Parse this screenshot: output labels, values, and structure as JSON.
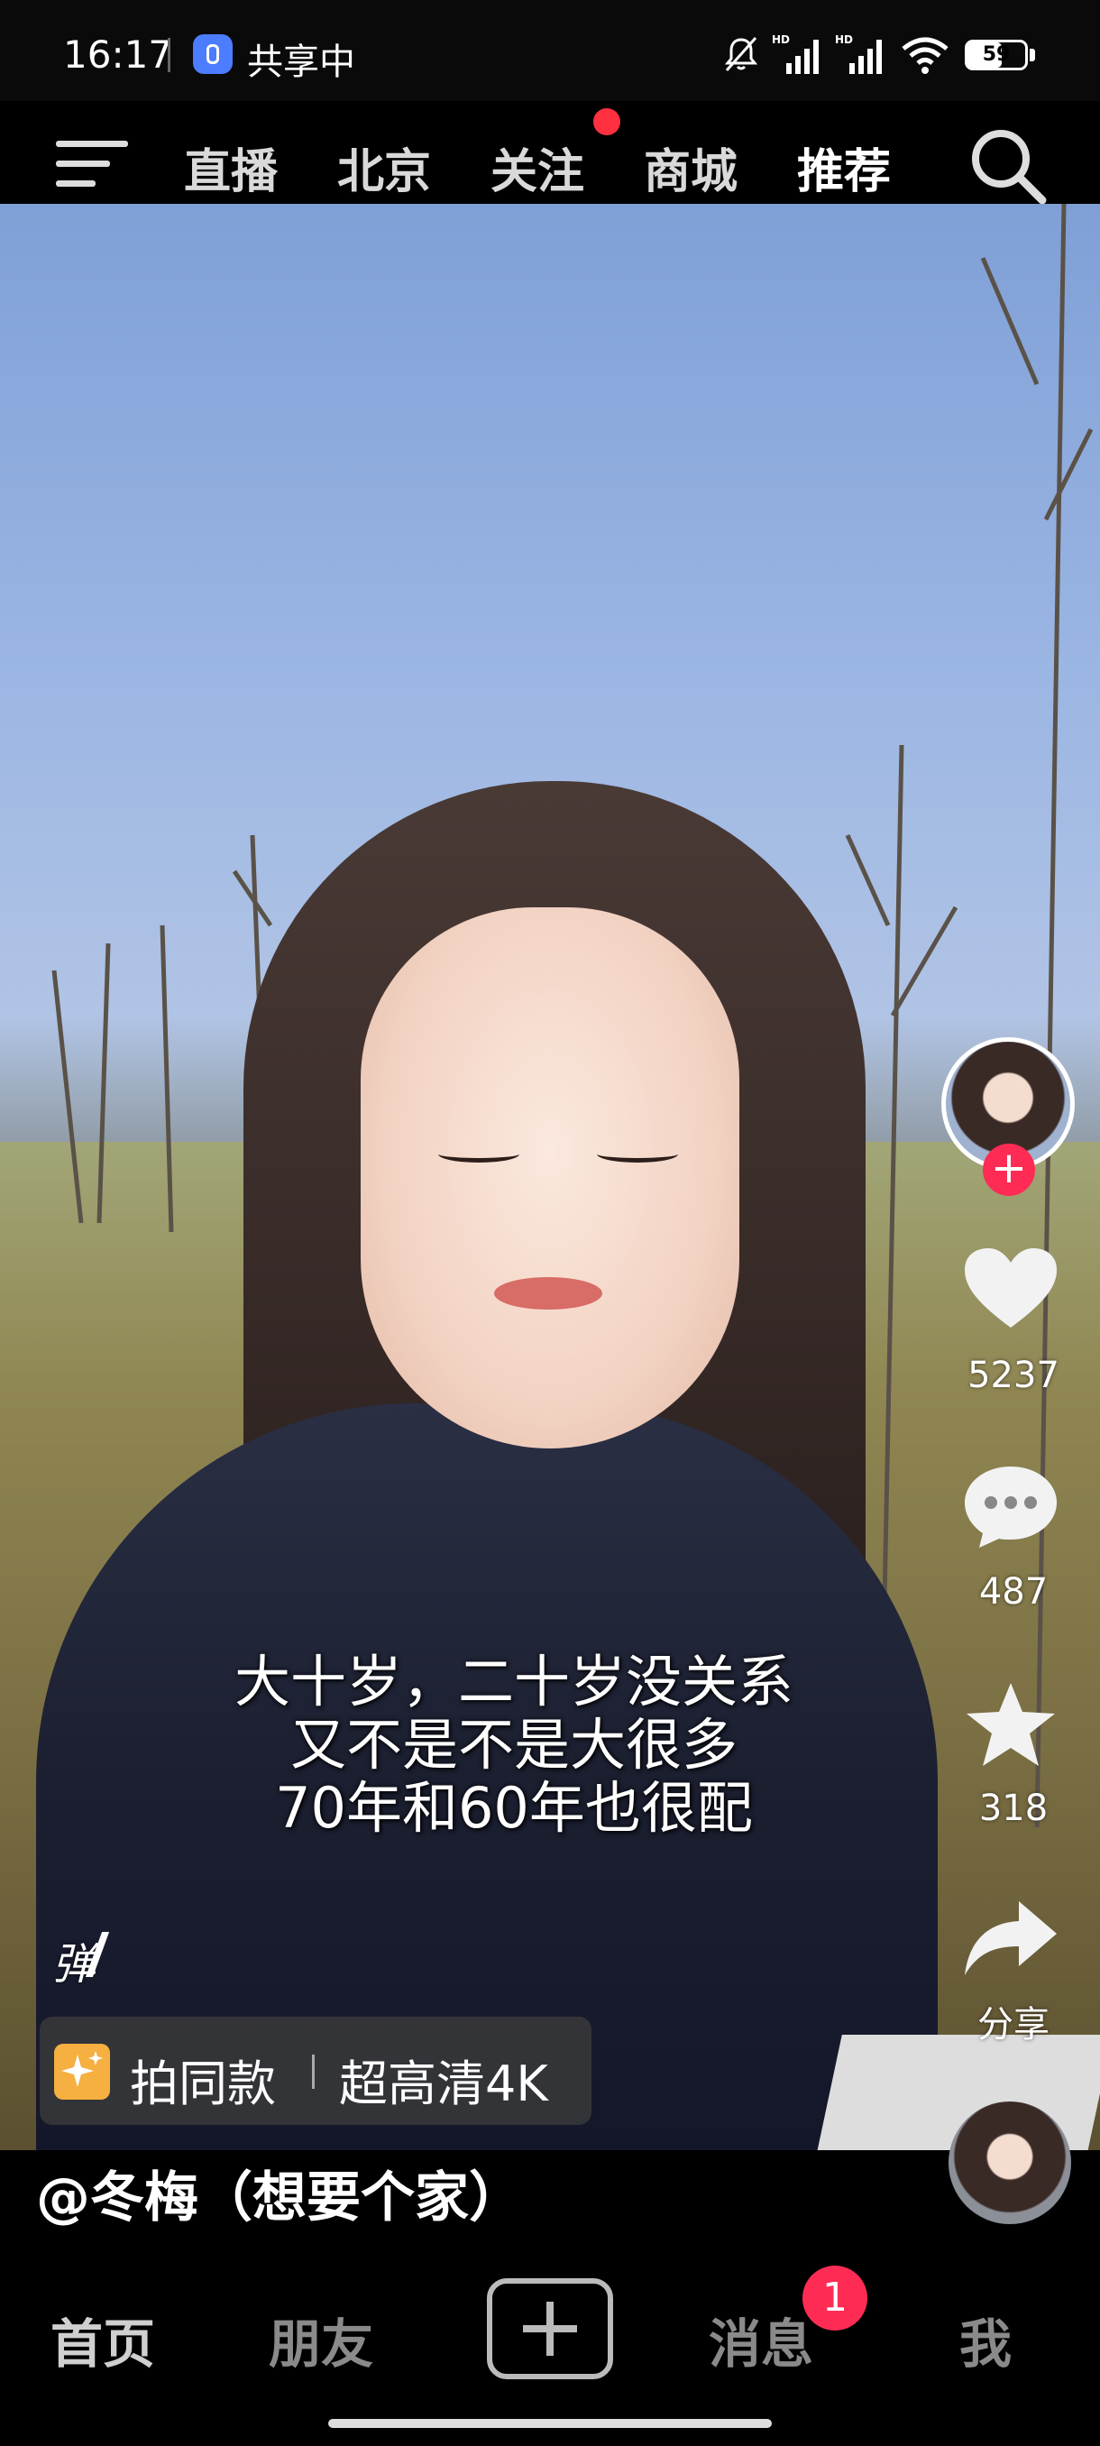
{
  "status_bar": {
    "time": "16:17",
    "share_label": "共享中",
    "battery": "59",
    "icons": [
      "share-screen-icon",
      "mute-bell-icon",
      "signal-hd-icon",
      "signal-hd-icon",
      "wifi-icon",
      "battery-icon"
    ]
  },
  "top_nav": {
    "tabs": [
      "直播",
      "北京",
      "关注",
      "商城",
      "推荐"
    ],
    "active_tab": "推荐",
    "icons": [
      "menu-icon",
      "search-icon"
    ]
  },
  "video": {
    "caption": [
      "大十岁，二十岁没关系",
      "又不是不是大很多",
      "70年和60年也很配"
    ],
    "danmu_label": "弹",
    "template_label": "拍同款",
    "quality_label": "超高清4K",
    "author": "@冬梅（想要个家）"
  },
  "side_rail": {
    "follow_plus": "+",
    "likes": "5237",
    "comments": "487",
    "favorites": "318",
    "share_label": "分享"
  },
  "bottom_nav": {
    "home": "首页",
    "friends": "朋友",
    "messages": "消息",
    "me": "我",
    "message_badge": "1"
  },
  "colors": {
    "accent": "#fe2c55",
    "notification_dot": "#ff3040",
    "background": "#000000"
  }
}
